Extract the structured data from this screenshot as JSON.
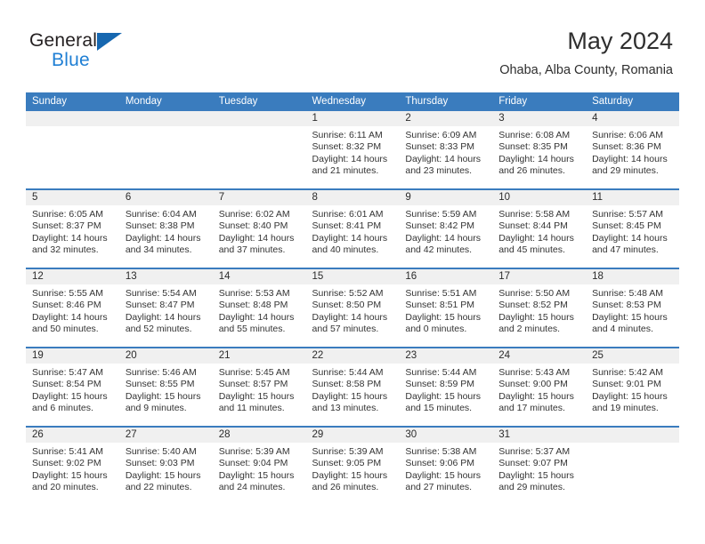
{
  "brand": {
    "name_part1": "General",
    "name_part2": "Blue",
    "logo_icon": "triangle-logo-icon"
  },
  "header": {
    "month_title": "May 2024",
    "location": "Ohaba, Alba County, Romania"
  },
  "colors": {
    "header_blue": "#3a7cbe",
    "row_divider_blue": "#3a7cbe",
    "daynum_band": "#f0f0f0",
    "brand_blue": "#1f7fd4",
    "logo_blue": "#1667b0",
    "text": "#333333"
  },
  "calendar": {
    "weekday_headers": [
      "Sunday",
      "Monday",
      "Tuesday",
      "Wednesday",
      "Thursday",
      "Friday",
      "Saturday"
    ],
    "weeks": [
      [
        {
          "day": "",
          "lines": []
        },
        {
          "day": "",
          "lines": []
        },
        {
          "day": "",
          "lines": []
        },
        {
          "day": "1",
          "lines": [
            "Sunrise: 6:11 AM",
            "Sunset: 8:32 PM",
            "Daylight: 14 hours",
            "and 21 minutes."
          ]
        },
        {
          "day": "2",
          "lines": [
            "Sunrise: 6:09 AM",
            "Sunset: 8:33 PM",
            "Daylight: 14 hours",
            "and 23 minutes."
          ]
        },
        {
          "day": "3",
          "lines": [
            "Sunrise: 6:08 AM",
            "Sunset: 8:35 PM",
            "Daylight: 14 hours",
            "and 26 minutes."
          ]
        },
        {
          "day": "4",
          "lines": [
            "Sunrise: 6:06 AM",
            "Sunset: 8:36 PM",
            "Daylight: 14 hours",
            "and 29 minutes."
          ]
        }
      ],
      [
        {
          "day": "5",
          "lines": [
            "Sunrise: 6:05 AM",
            "Sunset: 8:37 PM",
            "Daylight: 14 hours",
            "and 32 minutes."
          ]
        },
        {
          "day": "6",
          "lines": [
            "Sunrise: 6:04 AM",
            "Sunset: 8:38 PM",
            "Daylight: 14 hours",
            "and 34 minutes."
          ]
        },
        {
          "day": "7",
          "lines": [
            "Sunrise: 6:02 AM",
            "Sunset: 8:40 PM",
            "Daylight: 14 hours",
            "and 37 minutes."
          ]
        },
        {
          "day": "8",
          "lines": [
            "Sunrise: 6:01 AM",
            "Sunset: 8:41 PM",
            "Daylight: 14 hours",
            "and 40 minutes."
          ]
        },
        {
          "day": "9",
          "lines": [
            "Sunrise: 5:59 AM",
            "Sunset: 8:42 PM",
            "Daylight: 14 hours",
            "and 42 minutes."
          ]
        },
        {
          "day": "10",
          "lines": [
            "Sunrise: 5:58 AM",
            "Sunset: 8:44 PM",
            "Daylight: 14 hours",
            "and 45 minutes."
          ]
        },
        {
          "day": "11",
          "lines": [
            "Sunrise: 5:57 AM",
            "Sunset: 8:45 PM",
            "Daylight: 14 hours",
            "and 47 minutes."
          ]
        }
      ],
      [
        {
          "day": "12",
          "lines": [
            "Sunrise: 5:55 AM",
            "Sunset: 8:46 PM",
            "Daylight: 14 hours",
            "and 50 minutes."
          ]
        },
        {
          "day": "13",
          "lines": [
            "Sunrise: 5:54 AM",
            "Sunset: 8:47 PM",
            "Daylight: 14 hours",
            "and 52 minutes."
          ]
        },
        {
          "day": "14",
          "lines": [
            "Sunrise: 5:53 AM",
            "Sunset: 8:48 PM",
            "Daylight: 14 hours",
            "and 55 minutes."
          ]
        },
        {
          "day": "15",
          "lines": [
            "Sunrise: 5:52 AM",
            "Sunset: 8:50 PM",
            "Daylight: 14 hours",
            "and 57 minutes."
          ]
        },
        {
          "day": "16",
          "lines": [
            "Sunrise: 5:51 AM",
            "Sunset: 8:51 PM",
            "Daylight: 15 hours",
            "and 0 minutes."
          ]
        },
        {
          "day": "17",
          "lines": [
            "Sunrise: 5:50 AM",
            "Sunset: 8:52 PM",
            "Daylight: 15 hours",
            "and 2 minutes."
          ]
        },
        {
          "day": "18",
          "lines": [
            "Sunrise: 5:48 AM",
            "Sunset: 8:53 PM",
            "Daylight: 15 hours",
            "and 4 minutes."
          ]
        }
      ],
      [
        {
          "day": "19",
          "lines": [
            "Sunrise: 5:47 AM",
            "Sunset: 8:54 PM",
            "Daylight: 15 hours",
            "and 6 minutes."
          ]
        },
        {
          "day": "20",
          "lines": [
            "Sunrise: 5:46 AM",
            "Sunset: 8:55 PM",
            "Daylight: 15 hours",
            "and 9 minutes."
          ]
        },
        {
          "day": "21",
          "lines": [
            "Sunrise: 5:45 AM",
            "Sunset: 8:57 PM",
            "Daylight: 15 hours",
            "and 11 minutes."
          ]
        },
        {
          "day": "22",
          "lines": [
            "Sunrise: 5:44 AM",
            "Sunset: 8:58 PM",
            "Daylight: 15 hours",
            "and 13 minutes."
          ]
        },
        {
          "day": "23",
          "lines": [
            "Sunrise: 5:44 AM",
            "Sunset: 8:59 PM",
            "Daylight: 15 hours",
            "and 15 minutes."
          ]
        },
        {
          "day": "24",
          "lines": [
            "Sunrise: 5:43 AM",
            "Sunset: 9:00 PM",
            "Daylight: 15 hours",
            "and 17 minutes."
          ]
        },
        {
          "day": "25",
          "lines": [
            "Sunrise: 5:42 AM",
            "Sunset: 9:01 PM",
            "Daylight: 15 hours",
            "and 19 minutes."
          ]
        }
      ],
      [
        {
          "day": "26",
          "lines": [
            "Sunrise: 5:41 AM",
            "Sunset: 9:02 PM",
            "Daylight: 15 hours",
            "and 20 minutes."
          ]
        },
        {
          "day": "27",
          "lines": [
            "Sunrise: 5:40 AM",
            "Sunset: 9:03 PM",
            "Daylight: 15 hours",
            "and 22 minutes."
          ]
        },
        {
          "day": "28",
          "lines": [
            "Sunrise: 5:39 AM",
            "Sunset: 9:04 PM",
            "Daylight: 15 hours",
            "and 24 minutes."
          ]
        },
        {
          "day": "29",
          "lines": [
            "Sunrise: 5:39 AM",
            "Sunset: 9:05 PM",
            "Daylight: 15 hours",
            "and 26 minutes."
          ]
        },
        {
          "day": "30",
          "lines": [
            "Sunrise: 5:38 AM",
            "Sunset: 9:06 PM",
            "Daylight: 15 hours",
            "and 27 minutes."
          ]
        },
        {
          "day": "31",
          "lines": [
            "Sunrise: 5:37 AM",
            "Sunset: 9:07 PM",
            "Daylight: 15 hours",
            "and 29 minutes."
          ]
        },
        {
          "day": "",
          "lines": []
        }
      ]
    ]
  }
}
